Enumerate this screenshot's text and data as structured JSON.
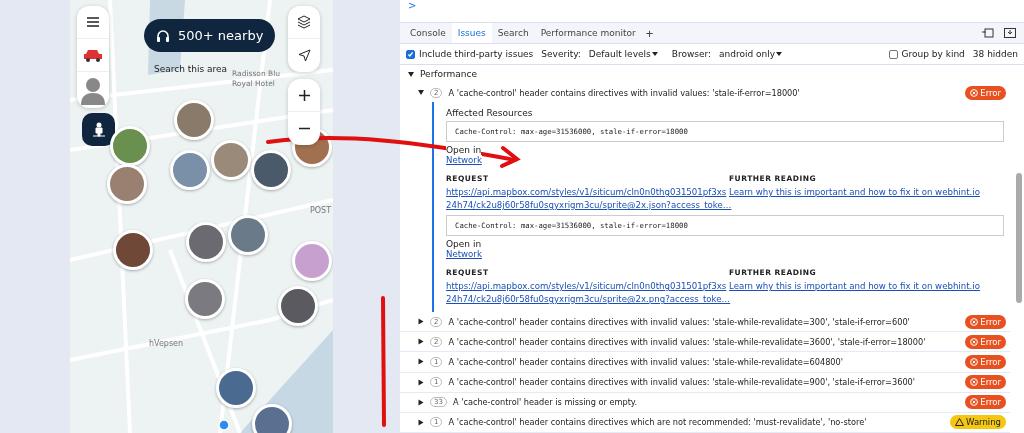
{
  "map": {
    "nearby_button": "500+ nearby",
    "search_area": "Search this area",
    "labels": [
      {
        "kind": "hotel",
        "text": "Radisson Blu"
      },
      {
        "kind": "hotel",
        "text": "Royal Hotel"
      },
      {
        "kind": "area",
        "text": "POST"
      },
      {
        "kind": "street",
        "text": "hVepsen"
      }
    ]
  },
  "devtools": {
    "prompt": ">",
    "tabs": [
      {
        "label": "Console",
        "selected": false
      },
      {
        "label": "Issues",
        "selected": true
      },
      {
        "label": "Search",
        "selected": false
      },
      {
        "label": "Performance monitor",
        "selected": false
      }
    ],
    "add_tab": "+",
    "toolbar": {
      "third_party": {
        "label": "Include third-party issues",
        "checked": true
      },
      "severity_label": "Severity:",
      "severity_value": "Default levels",
      "browser_label": "Browser:",
      "browser_value": "android only",
      "group_by_kind": {
        "label": "Group by kind",
        "checked": false
      },
      "hidden_count": "38 hidden"
    },
    "section": {
      "title": "Performance",
      "expanded": true
    },
    "issues": [
      {
        "count": "2",
        "title": "A 'cache-control' header contains directives with invalid values: 'stale-if-error=18000'",
        "kind": "error",
        "badge": "Error",
        "expanded": true,
        "details": {
          "affected_label": "Affected Resources",
          "resources": [
            {
              "header": "Cache-Control: max-age=31536000, stale-if-error=18000",
              "open_in": "Open in",
              "link": "Network",
              "request_label": "REQUEST",
              "url_lines": [
                "https://api.mapbox.com/styles/v1/siticum/cln0n0thg031501pf3xs",
                "24h74/ck2u8j60r58fu0sgyxrigm3cu/sprite@2x.json?access_toke…"
              ],
              "further_label": "FURTHER READING",
              "further_link": "Learn why this is important and how to fix it on webhint.io"
            },
            {
              "header": "Cache-Control: max-age=31536000, stale-if-error=18000",
              "open_in": "Open in",
              "link": "Network",
              "request_label": "REQUEST",
              "url_lines": [
                "https://api.mapbox.com/styles/v1/siticum/cln0n0thg031501pf3xs",
                "24h74/ck2u8j60r58fu0sgyxrigm3cu/sprite@2x.png?access_toke…"
              ],
              "further_label": "FURTHER READING",
              "further_link": "Learn why this is important and how to fix it on webhint.io"
            }
          ]
        }
      },
      {
        "count": "2",
        "title": "A 'cache-control' header contains directives with invalid values: 'stale-while-revalidate=300', 'stale-if-error=600'",
        "kind": "error",
        "badge": "Error",
        "expanded": false
      },
      {
        "count": "2",
        "title": "A 'cache-control' header contains directives with invalid values: 'stale-while-revalidate=3600', 'stale-if-error=18000'",
        "kind": "error",
        "badge": "Error",
        "expanded": false
      },
      {
        "count": "1",
        "title": "A 'cache-control' header contains directives with invalid values: 'stale-while-revalidate=604800'",
        "kind": "error",
        "badge": "Error",
        "expanded": false
      },
      {
        "count": "1",
        "title": "A 'cache-control' header contains directives with invalid values: 'stale-while-revalidate=900', 'stale-if-error=3600'",
        "kind": "error",
        "badge": "Error",
        "expanded": false
      },
      {
        "count": "33",
        "title": "A 'cache-control' header is missing or empty.",
        "kind": "error",
        "badge": "Error",
        "expanded": false
      },
      {
        "count": "1",
        "title": "A 'cache-control' header contains directives which are not recommended: 'must-revalidate', 'no-store'",
        "kind": "warning",
        "badge": "Warning",
        "expanded": false
      }
    ]
  }
}
